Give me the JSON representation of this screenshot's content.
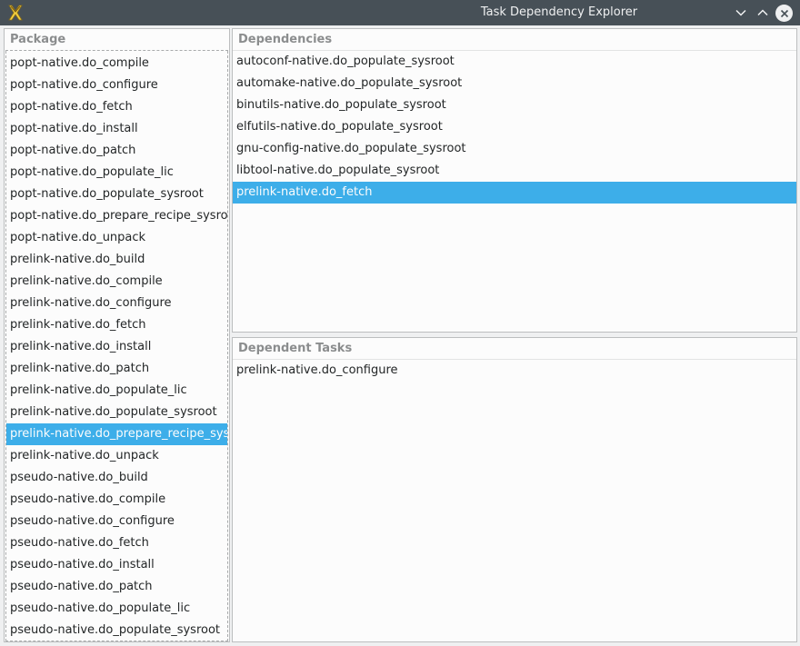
{
  "window": {
    "title": "Task Dependency Explorer",
    "icons": {
      "app": "app-icon",
      "minimize": "chevron-down-icon",
      "maximize": "chevron-up-icon",
      "close": "close-icon"
    }
  },
  "package_list": {
    "header": "Package",
    "items": [
      "popt-native.do_compile",
      "popt-native.do_configure",
      "popt-native.do_fetch",
      "popt-native.do_install",
      "popt-native.do_patch",
      "popt-native.do_populate_lic",
      "popt-native.do_populate_sysroot",
      "popt-native.do_prepare_recipe_sysroot",
      "popt-native.do_unpack",
      "prelink-native.do_build",
      "prelink-native.do_compile",
      "prelink-native.do_configure",
      "prelink-native.do_fetch",
      "prelink-native.do_install",
      "prelink-native.do_patch",
      "prelink-native.do_populate_lic",
      "prelink-native.do_populate_sysroot",
      "prelink-native.do_prepare_recipe_sysroot",
      "prelink-native.do_unpack",
      "pseudo-native.do_build",
      "pseudo-native.do_compile",
      "pseudo-native.do_configure",
      "pseudo-native.do_fetch",
      "pseudo-native.do_install",
      "pseudo-native.do_patch",
      "pseudo-native.do_populate_lic",
      "pseudo-native.do_populate_sysroot"
    ],
    "selected": "prelink-native.do_prepare_recipe_sysroot"
  },
  "dependencies": {
    "header": "Dependencies",
    "items": [
      "autoconf-native.do_populate_sysroot",
      "automake-native.do_populate_sysroot",
      "binutils-native.do_populate_sysroot",
      "elfutils-native.do_populate_sysroot",
      "gnu-config-native.do_populate_sysroot",
      "libtool-native.do_populate_sysroot",
      "prelink-native.do_fetch"
    ],
    "selected": "prelink-native.do_fetch"
  },
  "dependent_tasks": {
    "header": "Dependent Tasks",
    "items": [
      "prelink-native.do_configure"
    ]
  },
  "colors": {
    "titlebar": "#475057",
    "selection": "#3daee9",
    "window_bg": "#eff0f1",
    "panel_bg": "#fcfcfc"
  }
}
